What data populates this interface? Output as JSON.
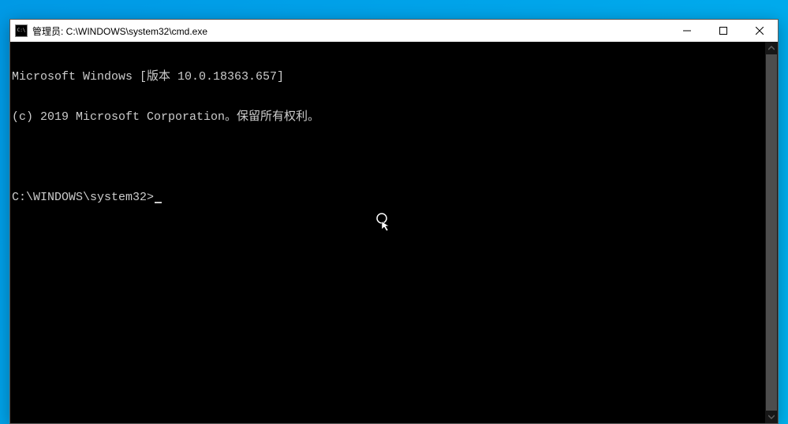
{
  "window": {
    "title": "管理员: C:\\WINDOWS\\system32\\cmd.exe",
    "icon_label": "C:\\"
  },
  "terminal": {
    "line1": "Microsoft Windows [版本 10.0.18363.657]",
    "line2": "(c) 2019 Microsoft Corporation。保留所有权利。",
    "blank": "",
    "prompt": "C:\\WINDOWS\\system32>"
  }
}
